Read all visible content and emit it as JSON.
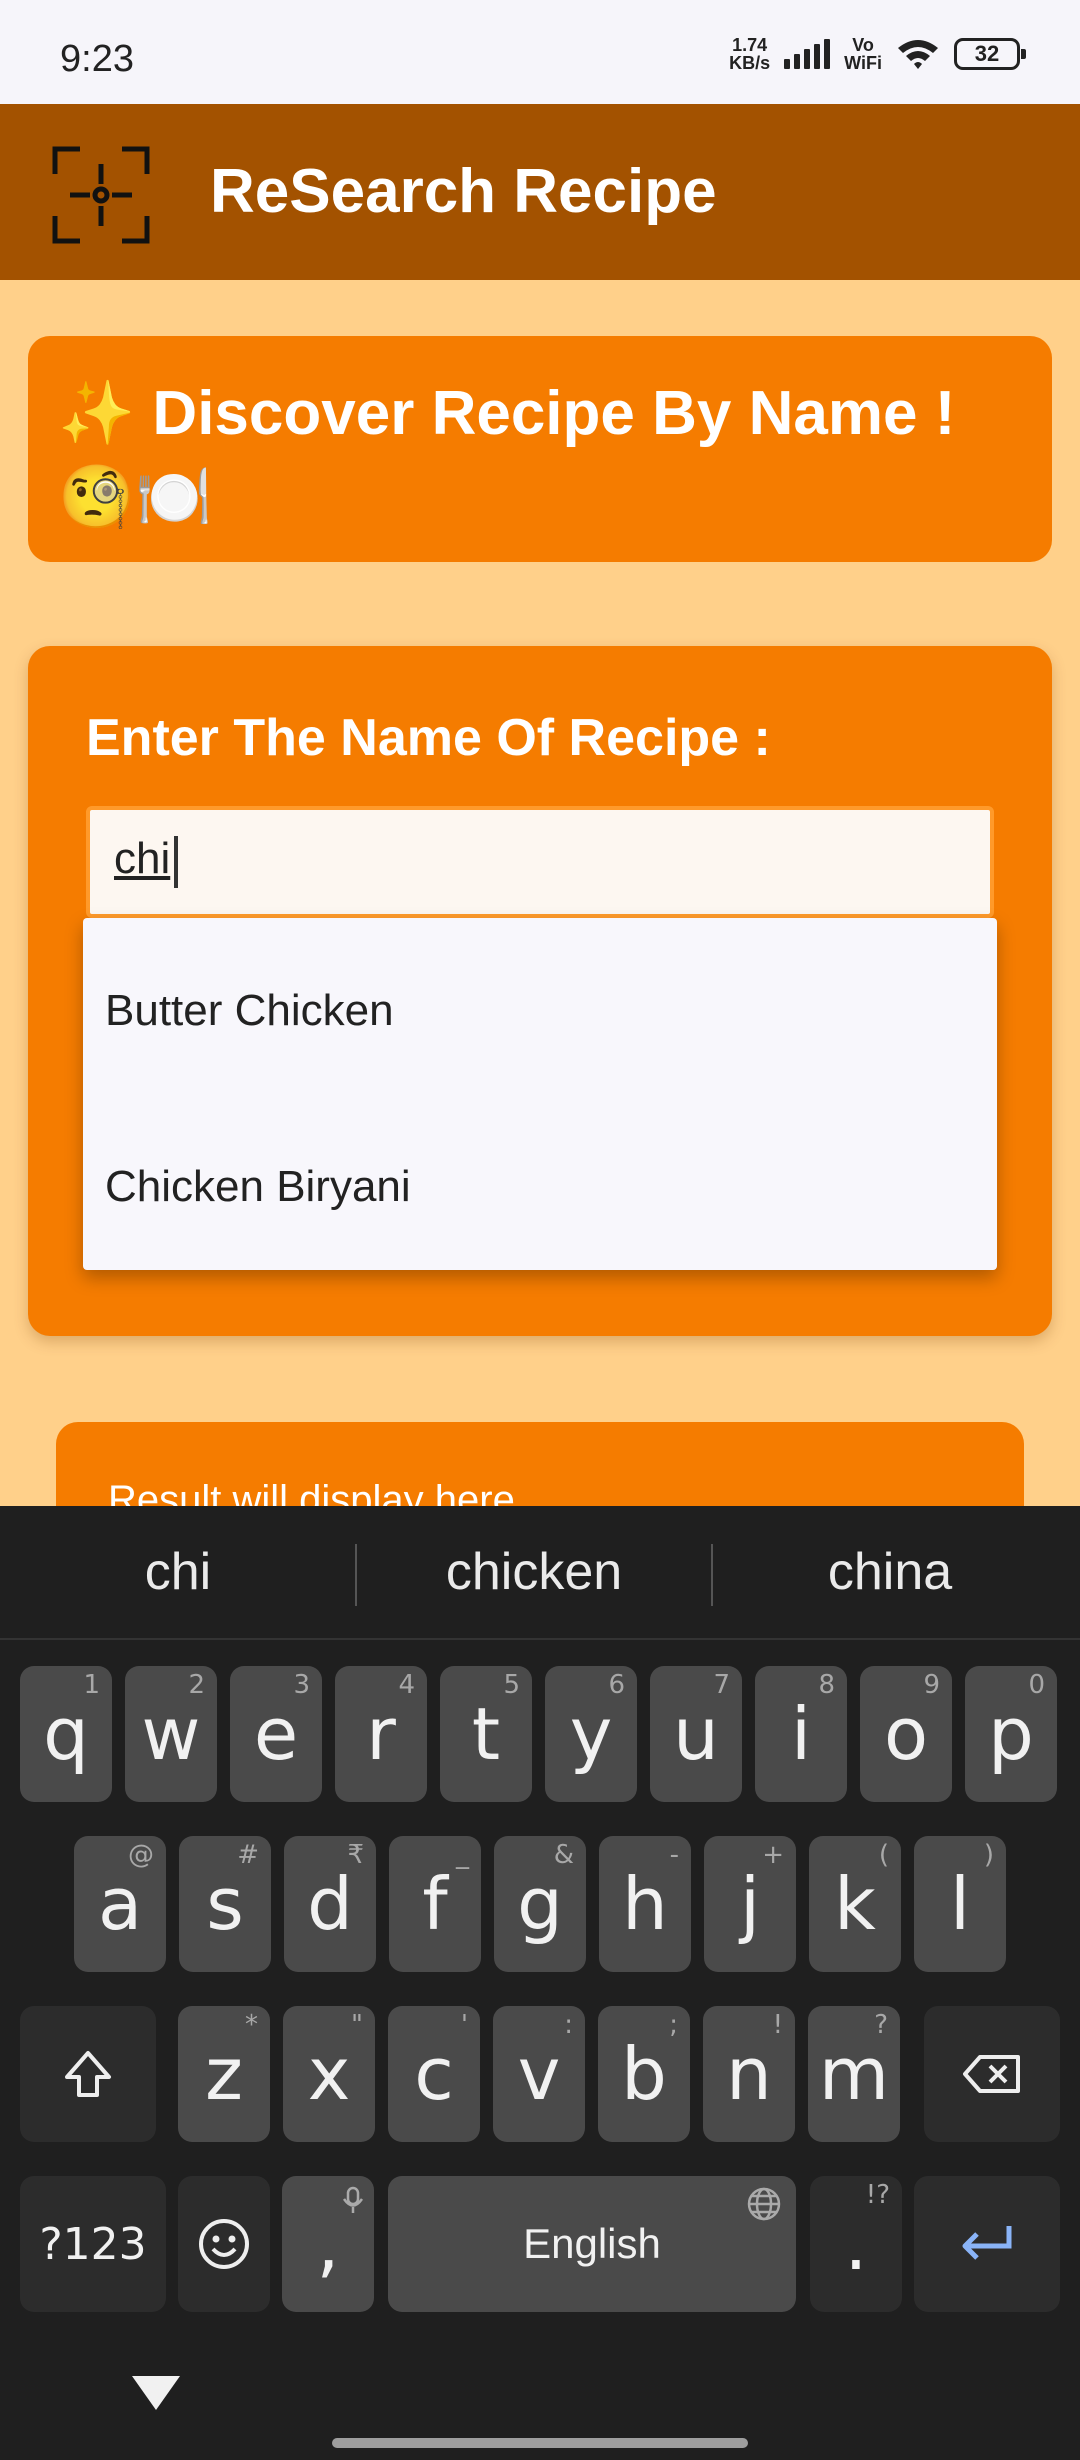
{
  "status": {
    "time": "9:23",
    "net_speed_value": "1.74",
    "net_speed_unit": "KB/s",
    "vowifi_top": "Vo",
    "vowifi_bottom": "WiFi",
    "battery": "32"
  },
  "appbar": {
    "title": "ReSearch Recipe",
    "icon": "scan-icon"
  },
  "title_card": {
    "text": "✨ Discover Recipe By Name ! 🧐🍽️"
  },
  "input_card": {
    "label": "Enter The Name Of Recipe :",
    "value": "chi"
  },
  "autocomplete": {
    "items": [
      "Butter Chicken",
      "Chicken Biryani"
    ]
  },
  "result_card": {
    "text": "Result will display here"
  },
  "keyboard": {
    "suggestions": [
      "chi",
      "chicken",
      "china"
    ],
    "row1": [
      {
        "k": "q",
        "h": "1"
      },
      {
        "k": "w",
        "h": "2"
      },
      {
        "k": "e",
        "h": "3"
      },
      {
        "k": "r",
        "h": "4"
      },
      {
        "k": "t",
        "h": "5"
      },
      {
        "k": "y",
        "h": "6"
      },
      {
        "k": "u",
        "h": "7"
      },
      {
        "k": "i",
        "h": "8"
      },
      {
        "k": "o",
        "h": "9"
      },
      {
        "k": "p",
        "h": "0"
      }
    ],
    "row2": [
      {
        "k": "a",
        "h": "@"
      },
      {
        "k": "s",
        "h": "#"
      },
      {
        "k": "d",
        "h": "₹"
      },
      {
        "k": "f",
        "h": "_"
      },
      {
        "k": "g",
        "h": "&"
      },
      {
        "k": "h",
        "h": "-"
      },
      {
        "k": "j",
        "h": "+"
      },
      {
        "k": "k",
        "h": "("
      },
      {
        "k": "l",
        "h": ")"
      }
    ],
    "row3": [
      {
        "k": "z",
        "h": "*"
      },
      {
        "k": "x",
        "h": "\""
      },
      {
        "k": "c",
        "h": "'"
      },
      {
        "k": "v",
        "h": ":"
      },
      {
        "k": "b",
        "h": ";"
      },
      {
        "k": "n",
        "h": "!"
      },
      {
        "k": "m",
        "h": "?"
      }
    ],
    "symbols_label": "?123",
    "comma": ",",
    "space_label": "English",
    "period": ".",
    "period_hint": "!?",
    "shift_icon": "shift-icon",
    "backspace_icon": "backspace-icon",
    "enter_icon": "enter-icon",
    "emoji_icon": "emoji-icon",
    "mic_icon": "mic-icon",
    "globe_icon": "globe-icon"
  },
  "colors": {
    "app_bar": "#a35200",
    "card": "#f57c00",
    "background": "#ffd08a",
    "keyboard": "#1f1f1f",
    "key": "#4a4a4a",
    "enter_accent": "#8ab4f8"
  }
}
